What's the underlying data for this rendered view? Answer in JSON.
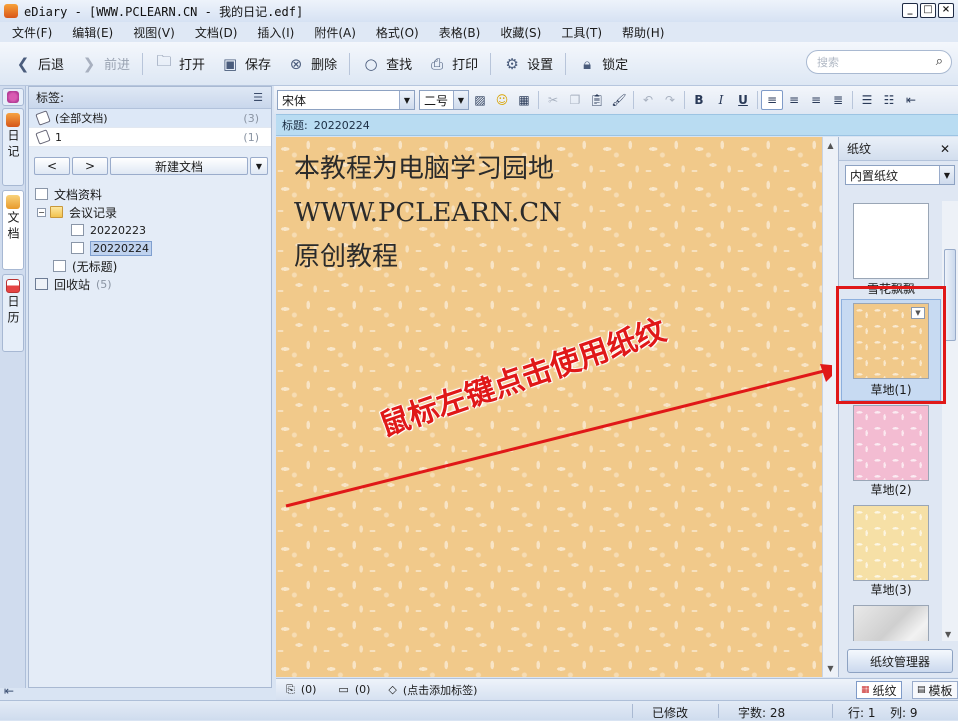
{
  "window": {
    "title": "eDiary - [WWW.PCLEARN.CN - 我的日记.edf]"
  },
  "menu": [
    "文件(F)",
    "编辑(E)",
    "视图(V)",
    "文档(D)",
    "插入(I)",
    "附件(A)",
    "格式(O)",
    "表格(B)",
    "收藏(S)",
    "工具(T)",
    "帮助(H)"
  ],
  "toolbar": {
    "back": "后退",
    "forward": "前进",
    "open": "打开",
    "save": "保存",
    "delete": "删除",
    "find": "查找",
    "print": "打印",
    "settings": "设置",
    "lock": "锁定",
    "search_placeholder": "搜索"
  },
  "vnav": {
    "diary": "日记",
    "docs": "文档",
    "calendar": "日历"
  },
  "tags": {
    "header": "标签:",
    "items": [
      {
        "label": "(全部文档)",
        "count": "(3)"
      },
      {
        "label": "1",
        "count": "(1)"
      }
    ]
  },
  "nav": {
    "prev": "<",
    "next": ">",
    "new_doc": "新建文档"
  },
  "tree": {
    "root": "文档资料",
    "folder": "会议记录",
    "docs": [
      "20220223",
      "20220224"
    ],
    "untitled": "(无标题)",
    "recycle": "回收站",
    "recycle_count": "(5)"
  },
  "format": {
    "font": "宋体",
    "size": "二号"
  },
  "doc": {
    "title_label": "标题:",
    "title_value": "20220224",
    "body_line1": "本教程为电脑学习园地WWW.PCLEARN.CN",
    "body_line2": "原创教程"
  },
  "paper": {
    "header": "纸纹",
    "select": "内置纸纹",
    "top_partial": "雪花飘飘",
    "items": [
      "草地(1)",
      "草地(2)",
      "草地(3)"
    ],
    "manager": "纸纹管理器"
  },
  "annotation": "鼠标左键点击使用纸纹",
  "editor_bottom": {
    "attach_count": "(0)",
    "comment_count": "(0)",
    "add_tag": "(点击添加标签)",
    "tab_paper": "纸纹",
    "tab_template": "模板"
  },
  "status": {
    "modified": "已修改",
    "chars": "字数: 28",
    "row": "行: 1",
    "col": "列: 9"
  },
  "colors": {
    "accent": "#e01818",
    "title_row": "#b9dcf2",
    "paper_bg": "#f1c98a"
  }
}
